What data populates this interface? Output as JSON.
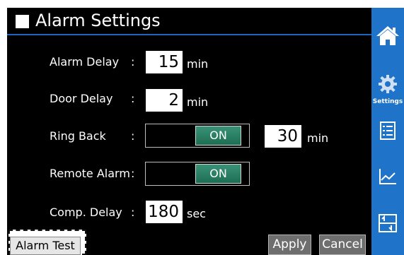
{
  "header": {
    "title": "Alarm Settings"
  },
  "settings": {
    "alarm_delay": {
      "label": "Alarm Delay",
      "colon": ":",
      "value": "15",
      "unit": "min"
    },
    "door_delay": {
      "label": "Door Delay",
      "colon": ":",
      "value": "2",
      "unit": "min"
    },
    "ring_back": {
      "label": "Ring Back",
      "colon": ":",
      "toggle": "ON",
      "value": "30",
      "unit": "min"
    },
    "remote_alarm": {
      "label": "Remote Alarm",
      "colon": ":",
      "toggle": "ON"
    },
    "comp_delay": {
      "label": "Comp. Delay",
      "colon": ":",
      "value": "180",
      "unit": "sec"
    }
  },
  "buttons": {
    "alarm_test": "Alarm Test",
    "apply": "Apply",
    "cancel": "Cancel"
  },
  "sidebar": {
    "items": [
      {
        "icon": "home-icon"
      },
      {
        "icon": "gear-icon",
        "label": "Settings"
      },
      {
        "icon": "list-icon"
      },
      {
        "icon": "chart-icon"
      },
      {
        "icon": "transfer-icon"
      }
    ]
  },
  "colors": {
    "accent": "#1f73c8",
    "toggle_on": "#2a8065",
    "background": "#000000"
  }
}
